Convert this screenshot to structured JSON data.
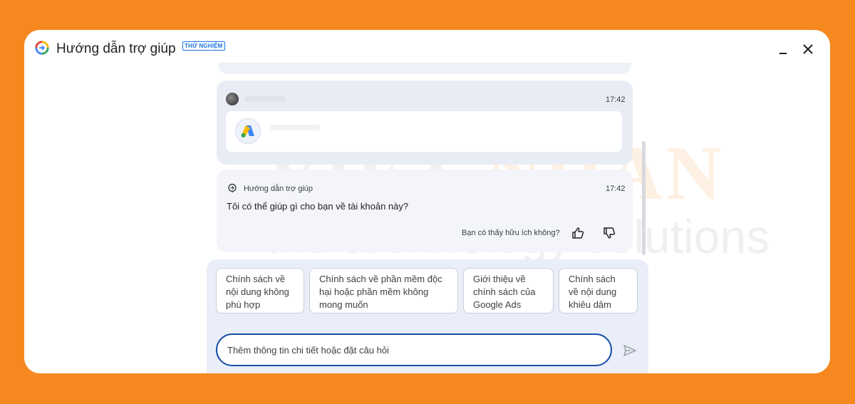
{
  "colors": {
    "background": "#f5891f",
    "accent": "#1a73e8",
    "input_border": "#174ea6"
  },
  "window": {
    "title": "Hướng dẫn trợ giúp",
    "badge": "THỬ NGHIỆM",
    "minimize_icon": "minimize-icon",
    "close_icon": "close-icon"
  },
  "watermark": {
    "word1": "VIET",
    "word2": "NHAN",
    "tagline": "the technology solutions"
  },
  "user_message": {
    "time": "17:42",
    "attachment_icon": "google-ads-icon"
  },
  "bot_message": {
    "sender": "Hướng dẫn trợ giúp",
    "time": "17:42",
    "text": "Tôi có thể giúp gì cho bạn về tài khoản này?",
    "feedback_question": "Bạn có thấy hữu ích không?",
    "thumb_up_icon": "thumb-up-icon",
    "thumb_down_icon": "thumb-down-icon"
  },
  "suggestions": [
    "Chính sách về nội dung không phù hợp",
    "Chính sách về phần mềm độc hại hoặc phần mềm không mong muốn",
    "Giới thiệu về chính sách của Google Ads",
    "Chính sách về nội dung khiêu dâm"
  ],
  "input": {
    "placeholder": "Thêm thông tin chi tiết hoặc đặt câu hỏi",
    "value": "",
    "send_icon": "send-icon"
  }
}
